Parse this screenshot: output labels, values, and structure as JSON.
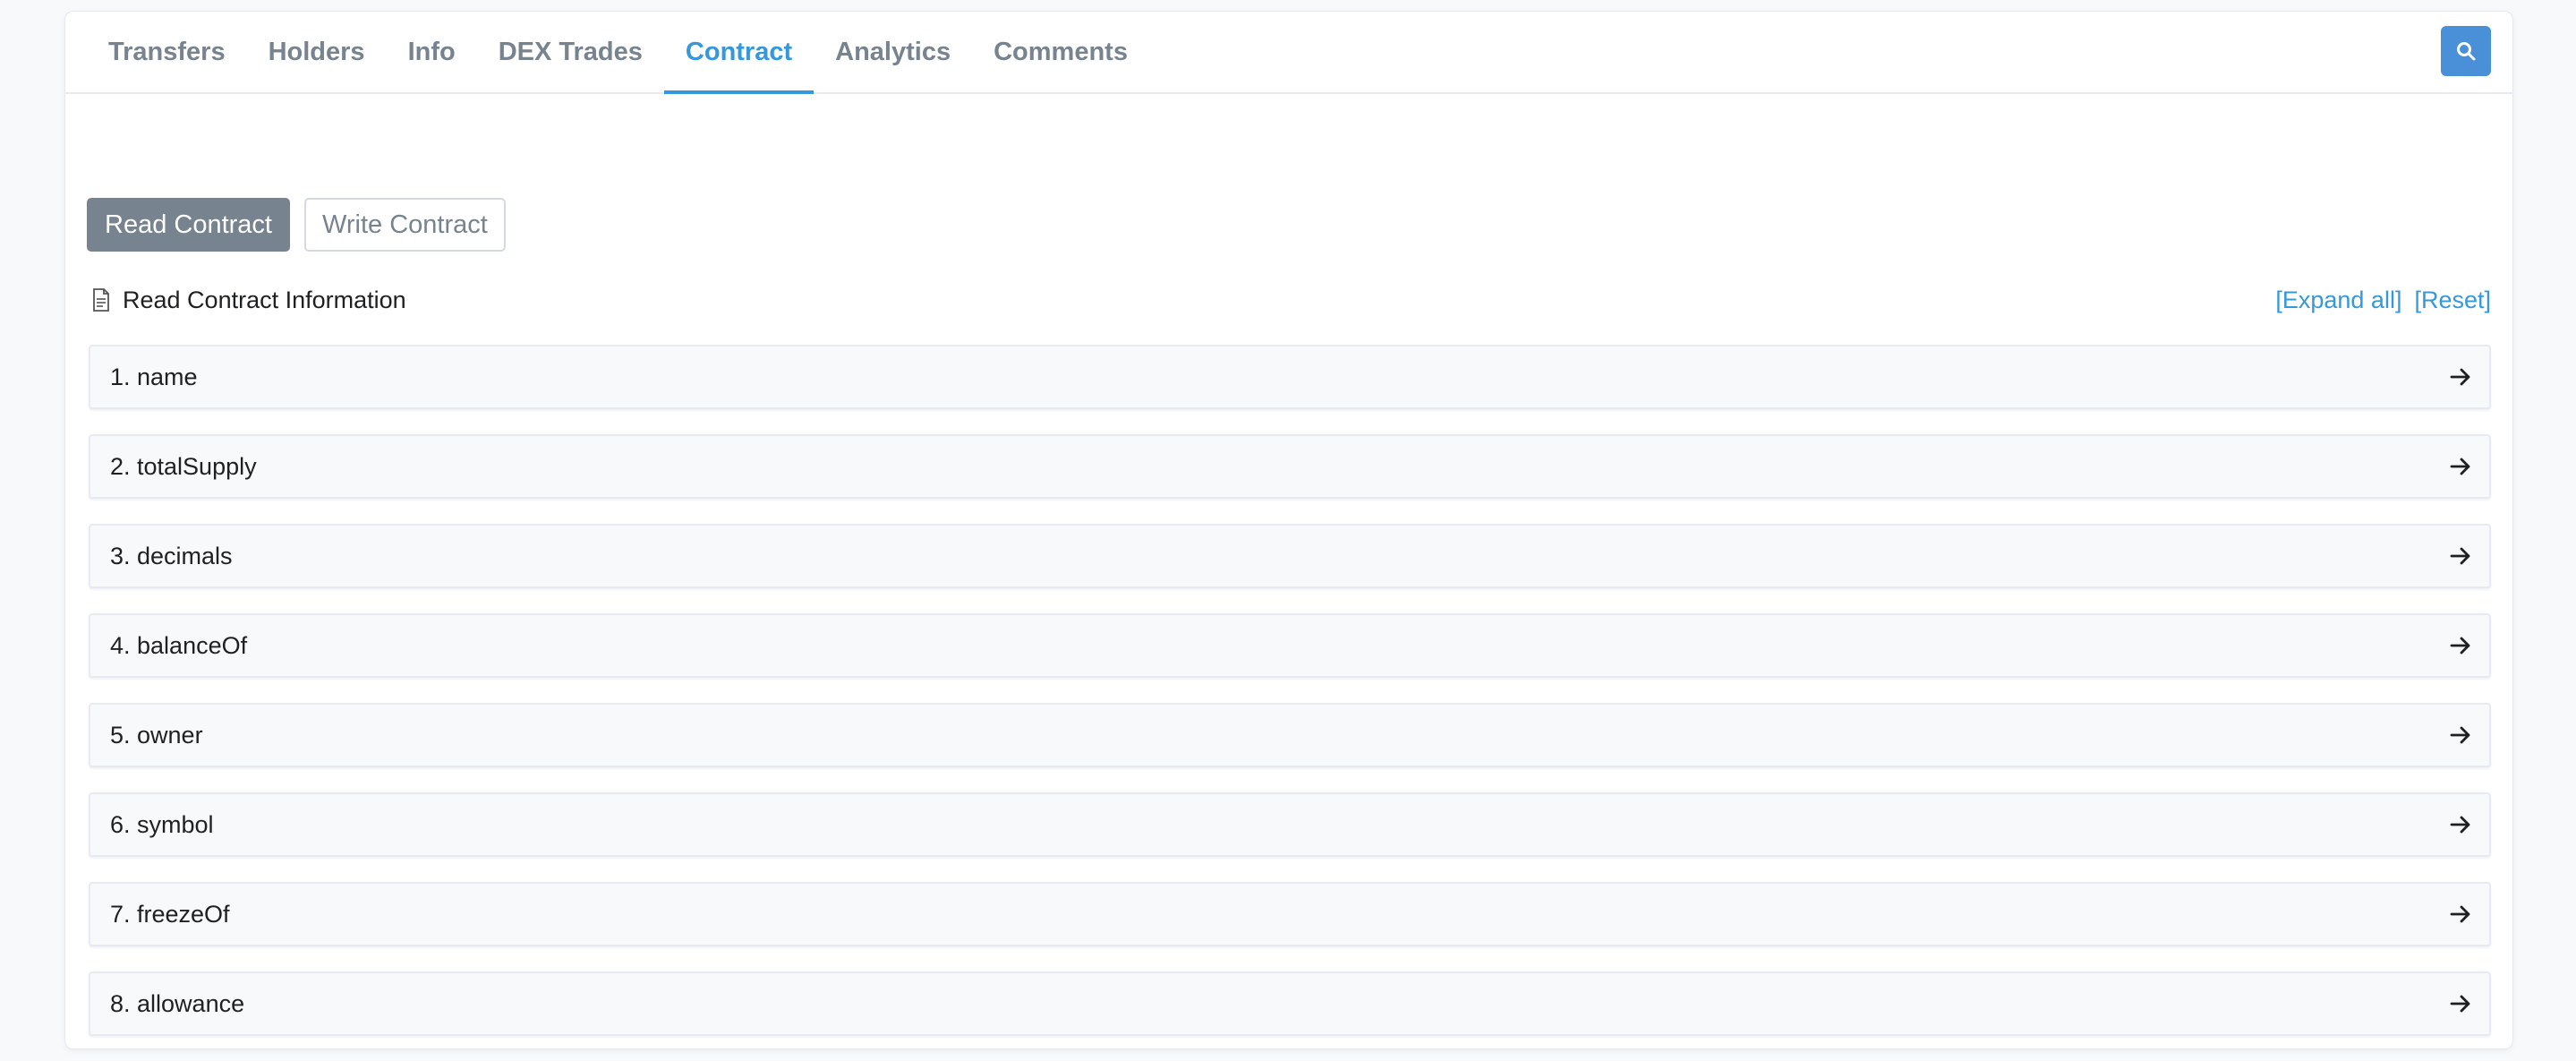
{
  "tabs": [
    {
      "label": "Transfers",
      "active": false
    },
    {
      "label": "Holders",
      "active": false
    },
    {
      "label": "Info",
      "active": false
    },
    {
      "label": "DEX Trades",
      "active": false
    },
    {
      "label": "Contract",
      "active": true
    },
    {
      "label": "Analytics",
      "active": false
    },
    {
      "label": "Comments",
      "active": false
    }
  ],
  "search": {
    "icon": "search-icon"
  },
  "contract_buttons": {
    "read_label": "Read Contract",
    "write_label": "Write Contract"
  },
  "info": {
    "title": "Read Contract Information",
    "icon": "document-icon",
    "expand_all": "[Expand all]",
    "reset": "[Reset]"
  },
  "functions": [
    {
      "label": "1. name"
    },
    {
      "label": "2. totalSupply"
    },
    {
      "label": "3. decimals"
    },
    {
      "label": "4. balanceOf"
    },
    {
      "label": "5. owner"
    },
    {
      "label": "6. symbol"
    },
    {
      "label": "7. freezeOf"
    },
    {
      "label": "8. allowance"
    }
  ],
  "colors": {
    "accent": "#3498db",
    "muted": "#77838f",
    "search_button": "#4a90d9"
  }
}
